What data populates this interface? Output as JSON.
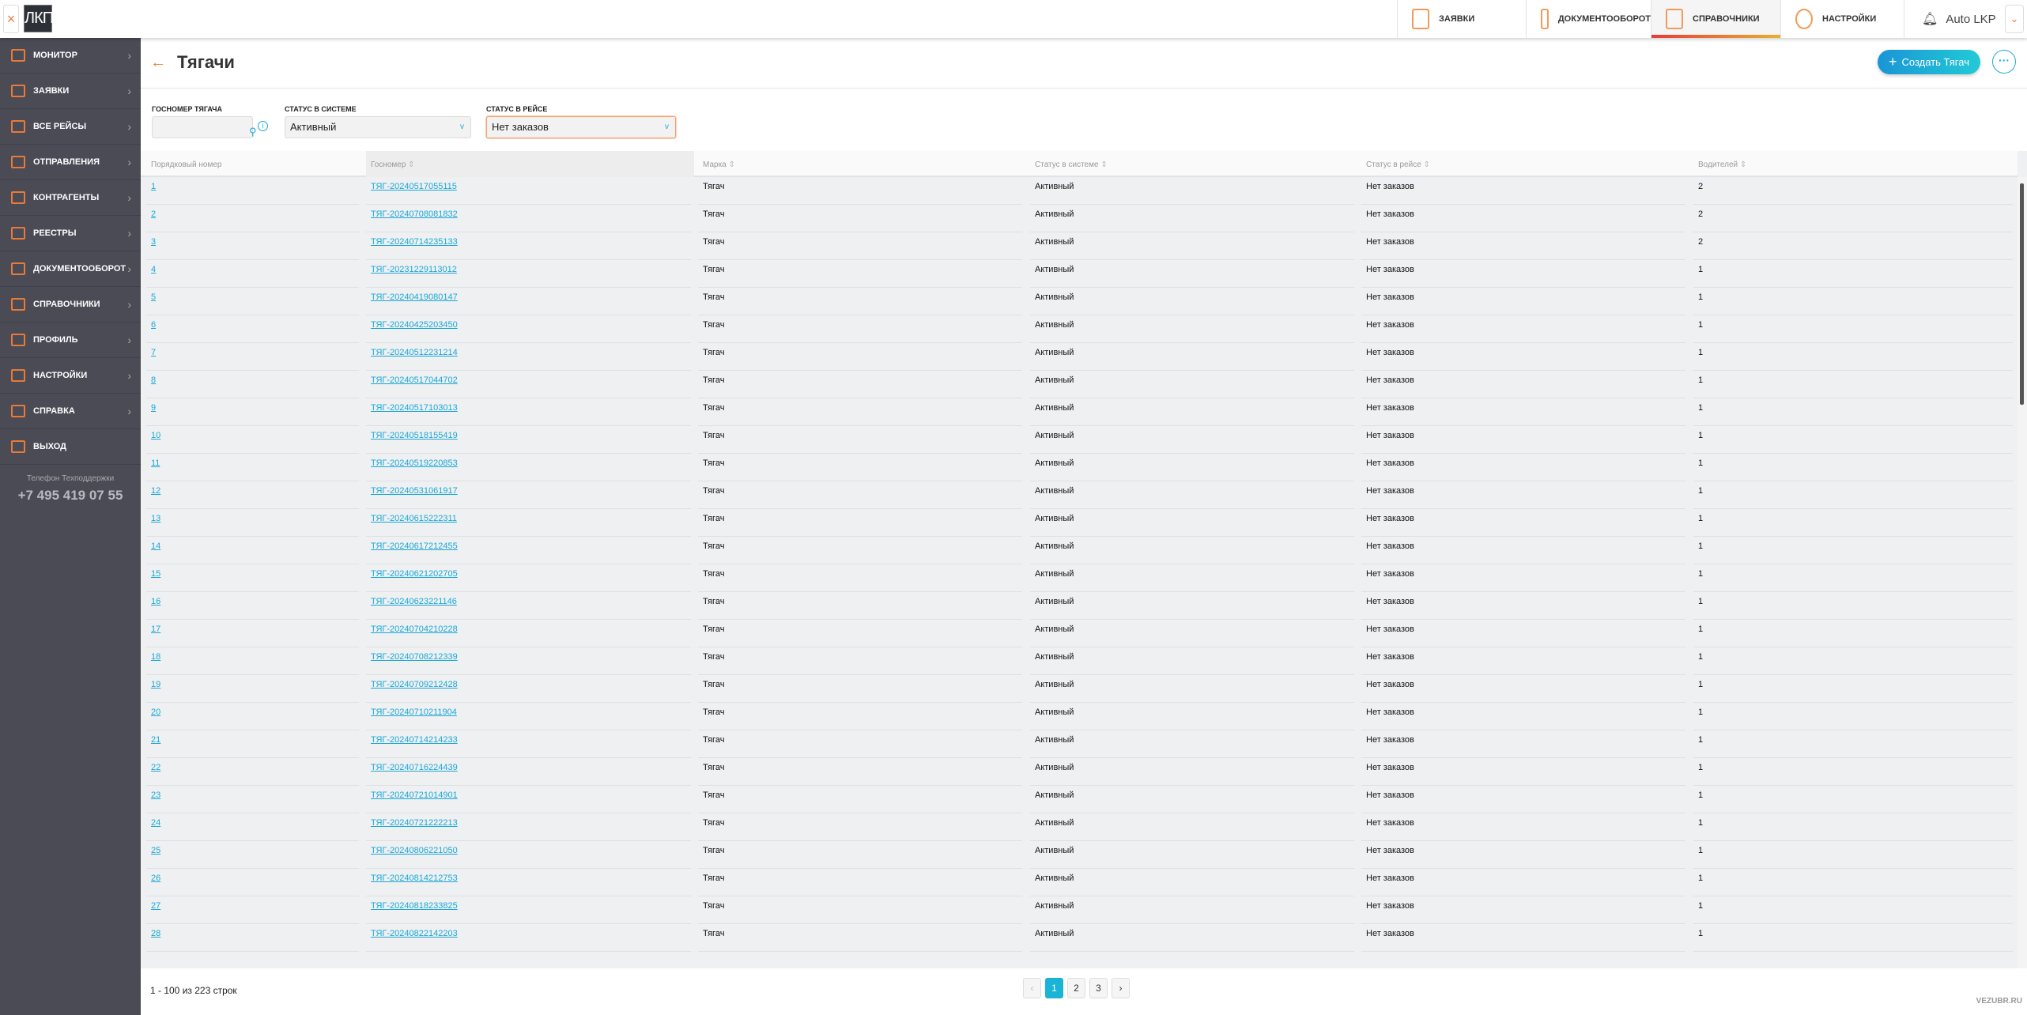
{
  "header": {
    "close_icon": "×",
    "logo": "ЛКП",
    "nav": [
      {
        "label": "ЗАЯВКИ",
        "active": false
      },
      {
        "label": "ДОКУМЕНТООБОРОТ",
        "active": false
      },
      {
        "label": "СПРАВОЧНИКИ",
        "active": true
      },
      {
        "label": "НАСТРОЙКИ",
        "active": false
      }
    ],
    "user_name": "Auto LKP"
  },
  "sidebar": {
    "items": [
      {
        "label": "МОНИТОР",
        "icon": "monitor-icon"
      },
      {
        "label": "ЗАЯВКИ",
        "icon": "orders-icon"
      },
      {
        "label": "ВСЕ РЕЙСЫ",
        "icon": "list-icon"
      },
      {
        "label": "ОТПРАВЛЕНИЯ",
        "icon": "shipments-icon"
      },
      {
        "label": "КОНТРАГЕНТЫ",
        "icon": "partners-icon"
      },
      {
        "label": "РЕЕСТРЫ",
        "icon": "registry-icon"
      },
      {
        "label": "ДОКУМЕНТООБОРОТ",
        "icon": "documents-icon"
      },
      {
        "label": "СПРАВОЧНИКИ",
        "icon": "book-icon"
      },
      {
        "label": "ПРОФИЛЬ",
        "icon": "profile-icon"
      },
      {
        "label": "НАСТРОЙКИ",
        "icon": "gear-icon"
      },
      {
        "label": "СПРАВКА",
        "icon": "help-icon"
      },
      {
        "label": "ВЫХОД",
        "icon": "logout-icon"
      }
    ],
    "support_label": "Телефон Техподдержки",
    "support_phone": "+7 495 419 07 55"
  },
  "page": {
    "title": "Тягачи",
    "create_label": "Создать Тягач",
    "more_label": "···"
  },
  "filters": {
    "plate_label": "ГОСНОМЕР ТЯГАЧА",
    "plate_value": "",
    "system_status_label": "СТАТУС В СИСТЕМЕ",
    "system_status_value": "Активный",
    "trip_status_label": "СТАТУС В РЕЙСЕ",
    "trip_status_value": "Нет заказов"
  },
  "table": {
    "columns": [
      "Порядковый номер",
      "Госномер",
      "Марка",
      "Статус в системе",
      "Статус в рейсе",
      "Водителей"
    ],
    "rows": [
      [
        "1",
        "ТЯГ-20240517055115",
        "Тягач",
        "Активный",
        "Нет заказов",
        "2"
      ],
      [
        "2",
        "ТЯГ-20240708081832",
        "Тягач",
        "Активный",
        "Нет заказов",
        "2"
      ],
      [
        "3",
        "ТЯГ-20240714235133",
        "Тягач",
        "Активный",
        "Нет заказов",
        "2"
      ],
      [
        "4",
        "ТЯГ-20231229113012",
        "Тягач",
        "Активный",
        "Нет заказов",
        "1"
      ],
      [
        "5",
        "ТЯГ-20240419080147",
        "Тягач",
        "Активный",
        "Нет заказов",
        "1"
      ],
      [
        "6",
        "ТЯГ-20240425203450",
        "Тягач",
        "Активный",
        "Нет заказов",
        "1"
      ],
      [
        "7",
        "ТЯГ-20240512231214",
        "Тягач",
        "Активный",
        "Нет заказов",
        "1"
      ],
      [
        "8",
        "ТЯГ-20240517044702",
        "Тягач",
        "Активный",
        "Нет заказов",
        "1"
      ],
      [
        "9",
        "ТЯГ-20240517103013",
        "Тягач",
        "Активный",
        "Нет заказов",
        "1"
      ],
      [
        "10",
        "ТЯГ-20240518155419",
        "Тягач",
        "Активный",
        "Нет заказов",
        "1"
      ],
      [
        "11",
        "ТЯГ-20240519220853",
        "Тягач",
        "Активный",
        "Нет заказов",
        "1"
      ],
      [
        "12",
        "ТЯГ-20240531061917",
        "Тягач",
        "Активный",
        "Нет заказов",
        "1"
      ],
      [
        "13",
        "ТЯГ-20240615222311",
        "Тягач",
        "Активный",
        "Нет заказов",
        "1"
      ],
      [
        "14",
        "ТЯГ-20240617212455",
        "Тягач",
        "Активный",
        "Нет заказов",
        "1"
      ],
      [
        "15",
        "ТЯГ-20240621202705",
        "Тягач",
        "Активный",
        "Нет заказов",
        "1"
      ],
      [
        "16",
        "ТЯГ-20240623221146",
        "Тягач",
        "Активный",
        "Нет заказов",
        "1"
      ],
      [
        "17",
        "ТЯГ-20240704210228",
        "Тягач",
        "Активный",
        "Нет заказов",
        "1"
      ],
      [
        "18",
        "ТЯГ-20240708212339",
        "Тягач",
        "Активный",
        "Нет заказов",
        "1"
      ],
      [
        "19",
        "ТЯГ-20240709212428",
        "Тягач",
        "Активный",
        "Нет заказов",
        "1"
      ],
      [
        "20",
        "ТЯГ-20240710211904",
        "Тягач",
        "Активный",
        "Нет заказов",
        "1"
      ],
      [
        "21",
        "ТЯГ-20240714214233",
        "Тягач",
        "Активный",
        "Нет заказов",
        "1"
      ],
      [
        "22",
        "ТЯГ-20240716224439",
        "Тягач",
        "Активный",
        "Нет заказов",
        "1"
      ],
      [
        "23",
        "ТЯГ-20240721014901",
        "Тягач",
        "Активный",
        "Нет заказов",
        "1"
      ],
      [
        "24",
        "ТЯГ-20240721222213",
        "Тягач",
        "Активный",
        "Нет заказов",
        "1"
      ],
      [
        "25",
        "ТЯГ-20240806221050",
        "Тягач",
        "Активный",
        "Нет заказов",
        "1"
      ],
      [
        "26",
        "ТЯГ-20240814212753",
        "Тягач",
        "Активный",
        "Нет заказов",
        "1"
      ],
      [
        "27",
        "ТЯГ-20240818233825",
        "Тягач",
        "Активный",
        "Нет заказов",
        "1"
      ],
      [
        "28",
        "ТЯГ-20240822142203",
        "Тягач",
        "Активный",
        "Нет заказов",
        "1"
      ]
    ]
  },
  "footer": {
    "count_text": "1 - 100 из 223 строк",
    "pages": [
      "1",
      "2",
      "3"
    ],
    "current_page": "1",
    "prev": "‹",
    "next": "›",
    "brand": "VEZUBR.RU"
  },
  "colors": {
    "accent": "#1ab4d6",
    "brand_orange": "#f07a3a",
    "sidebar": "#4a4b55"
  }
}
